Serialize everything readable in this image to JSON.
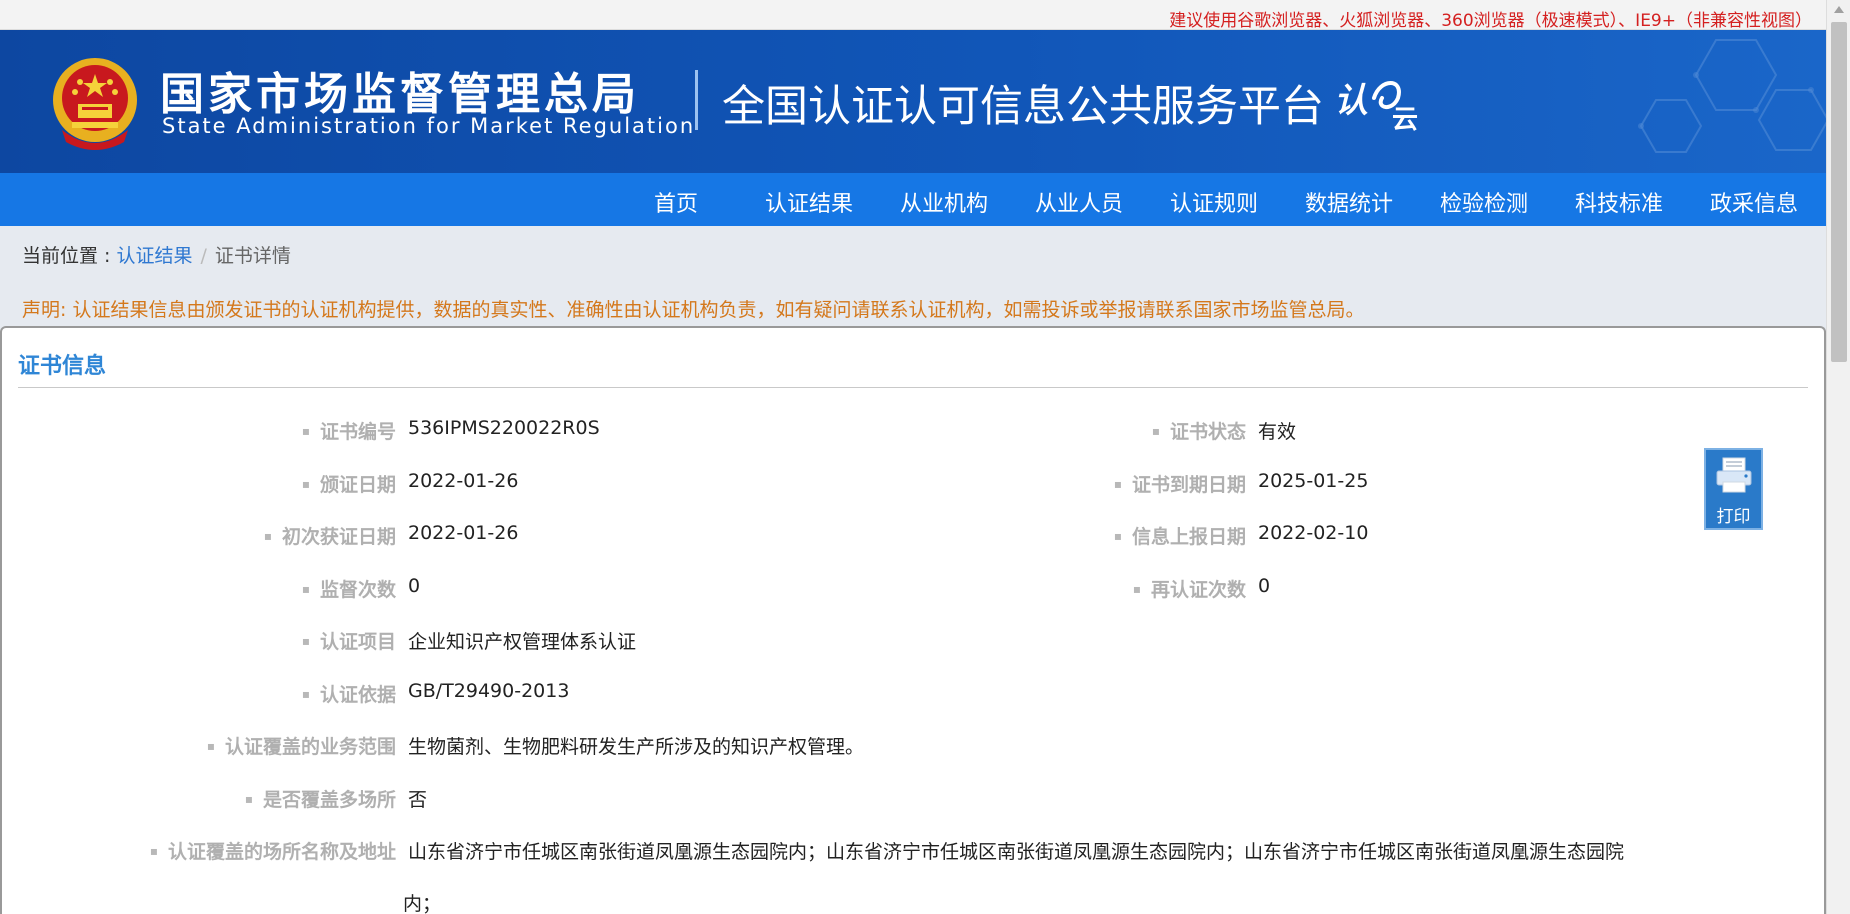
{
  "topbar": {
    "browser_note": "建议使用谷歌浏览器、火狐浏览器、360浏览器（极速模式）、IE9+（非兼容性视图）"
  },
  "header": {
    "agency_cn": "国家市场监督管理总局",
    "agency_en": "State Administration for Market Regulation",
    "platform_title": "全国认证认可信息公共服务平台",
    "brand_logo_text": "认e云"
  },
  "nav": {
    "items": [
      {
        "label": "首页"
      },
      {
        "label": "认证结果"
      },
      {
        "label": "从业机构"
      },
      {
        "label": "从业人员"
      },
      {
        "label": "认证规则"
      },
      {
        "label": "数据统计"
      },
      {
        "label": "检验检测"
      },
      {
        "label": "科技标准"
      },
      {
        "label": "政采信息"
      }
    ]
  },
  "breadcrumb": {
    "prefix": "当前位置 : ",
    "link": "认证结果",
    "separator": "/",
    "current": "证书详情"
  },
  "notice": "声明: 认证结果信息由颁发证书的认证机构提供，数据的真实性、准确性由认证机构负责，如有疑问请联系认证机构，如需投诉或举报请联系国家市场监管总局。",
  "panel": {
    "title": "证书信息",
    "print_label": "打印"
  },
  "cert": {
    "number_label": "证书编号",
    "number_value": "536IPMS220022R0S",
    "status_label": "证书状态",
    "status_value": "有效",
    "issue_date_label": "颁证日期",
    "issue_date_value": "2022-01-26",
    "expiry_date_label": "证书到期日期",
    "expiry_date_value": "2025-01-25",
    "first_date_label": "初次获证日期",
    "first_date_value": "2022-01-26",
    "report_date_label": "信息上报日期",
    "report_date_value": "2022-02-10",
    "supervision_label": "监督次数",
    "supervision_value": "0",
    "recert_label": "再认证次数",
    "recert_value": "0",
    "project_label": "认证项目",
    "project_value": "企业知识产权管理体系认证",
    "basis_label": "认证依据",
    "basis_value": "GB/T29490-2013",
    "scope_label": "认证覆盖的业务范围",
    "scope_value": "生物菌剂、生物肥料研发生产所涉及的知识产权管理。",
    "multisite_label": "是否覆盖多场所",
    "multisite_value": "否",
    "sites_label": "认证覆盖的场所名称及地址",
    "sites_value_line1": "山东省济宁市任城区南张街道凤凰源生态园院内；山东省济宁市任城区南张街道凤凰源生态园院内；山东省济宁市任城区南张街道凤凰源生态园院",
    "sites_value_line2": "内；"
  },
  "colors": {
    "header_blue": "#0d47a1",
    "nav_blue": "#1677e5",
    "notice_orange": "#d4781c",
    "title_blue": "#2f86d6",
    "warning_red": "#d42020"
  }
}
